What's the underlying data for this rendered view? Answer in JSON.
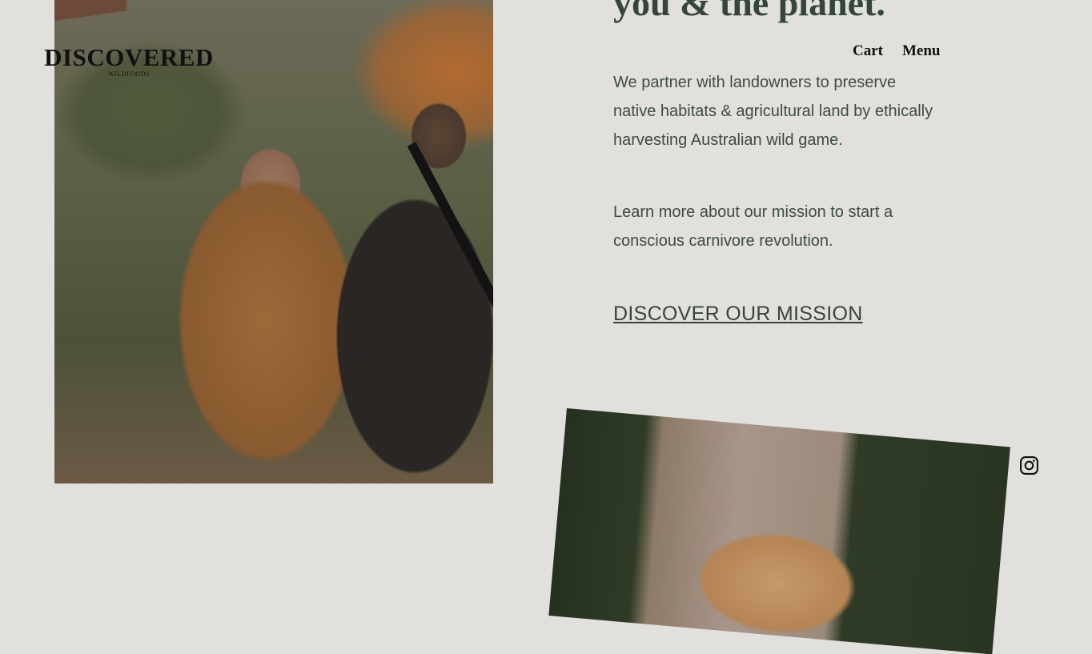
{
  "brand": {
    "name": "DISCOVERED",
    "tagline": "WILDFOODS"
  },
  "nav": {
    "cart_label": "Cart",
    "menu_label": "Menu"
  },
  "hero": {
    "heading_visible": "you & the planet.",
    "paragraph_1": "We partner with landowners to preserve native habitats & agricultural land by ethically harvesting Australian wild game.",
    "paragraph_2": "Learn more about our mission to start a conscious carnivore revolution.",
    "cta_label": "DISCOVER OUR MISSION"
  },
  "colors": {
    "background": "#e2e0dc",
    "heading": "#35453e",
    "body_text": "#3d4b45"
  },
  "icons": {
    "social": "instagram-icon"
  }
}
